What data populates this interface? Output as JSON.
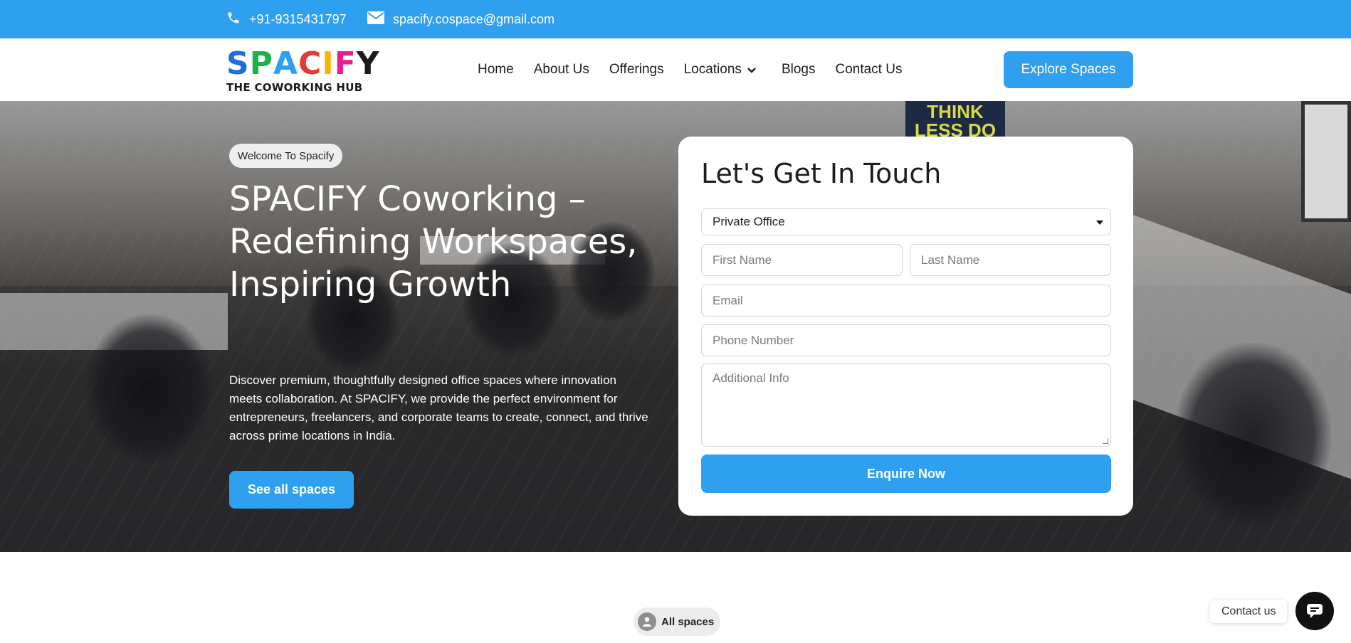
{
  "topbar": {
    "phone": "+91-9315431797",
    "email": "spacify.cospace@gmail.com",
    "phone_icon": "phone-icon",
    "email_icon": "envelope-icon"
  },
  "header": {
    "logo": {
      "letters": [
        "S",
        "P",
        "A",
        "C",
        "I",
        "F",
        "Y"
      ],
      "letter_colors": [
        "#1e6fd9",
        "#19b34a",
        "#2f9ff0",
        "#e53935",
        "#f4b400",
        "#e91e8c",
        "#1a1a1a"
      ],
      "tagline": "THE COWORKING HUB"
    },
    "nav": [
      {
        "label": "Home"
      },
      {
        "label": "About Us"
      },
      {
        "label": "Offerings"
      },
      {
        "label": "Locations",
        "has_dropdown": true
      },
      {
        "label": "Blogs"
      },
      {
        "label": "Contact Us"
      }
    ],
    "cta": "Explore Spaces"
  },
  "hero": {
    "badge": "Welcome To Spacify",
    "title": "SPACIFY Coworking – Redefining Workspaces, Inspiring Growth",
    "description": "Discover premium, thoughtfully designed office spaces where innovation meets collaboration. At SPACIFY, we provide the perfect environment for entrepreneurs, freelancers, and corporate teams to create, connect, and thrive across prime locations in India.",
    "button": "See all spaces",
    "poster_text": "THINK LESS DO"
  },
  "form": {
    "title": "Let's Get In Touch",
    "space_type": "Private Office",
    "first_name_placeholder": "First Name",
    "last_name_placeholder": "Last Name",
    "email_placeholder": "Email",
    "phone_placeholder": "Phone Number",
    "info_placeholder": "Additional Info",
    "submit": "Enquire Now"
  },
  "section": {
    "badge": "All spaces",
    "badge_icon": "user-avatar-icon"
  },
  "chat": {
    "label": "Contact us",
    "icon": "chat-bubble-icon"
  },
  "colors": {
    "accent": "#2f9ff0",
    "text_dark": "#1e1e1e"
  }
}
